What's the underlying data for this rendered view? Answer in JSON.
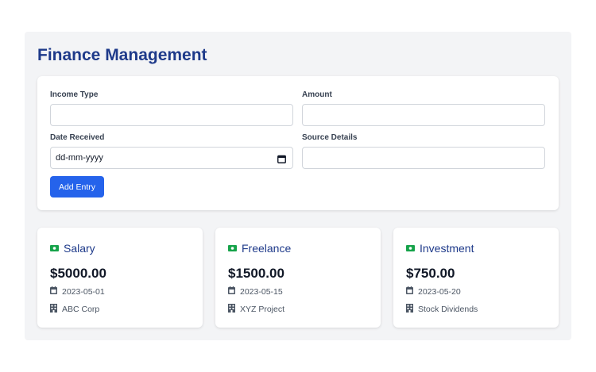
{
  "page": {
    "title": "Finance Management"
  },
  "form": {
    "income_type_label": "Income Type",
    "amount_label": "Amount",
    "date_label": "Date Received",
    "date_value": "dd-mm-yyyy",
    "source_label": "Source Details",
    "add_button": "Add Entry"
  },
  "entries": [
    {
      "type": "Salary",
      "amount": "$5000.00",
      "date": "2023-05-01",
      "source": "ABC Corp"
    },
    {
      "type": "Freelance",
      "amount": "$1500.00",
      "date": "2023-05-15",
      "source": "XYZ Project"
    },
    {
      "type": "Investment",
      "amount": "$750.00",
      "date": "2023-05-20",
      "source": "Stock Dividends"
    }
  ],
  "colors": {
    "accent": "#2563eb",
    "title": "#1e3a8a",
    "money_icon": "#16a34a"
  },
  "icons": {
    "entry_type": "money-icon",
    "date": "calendar-icon",
    "source": "building-icon"
  }
}
